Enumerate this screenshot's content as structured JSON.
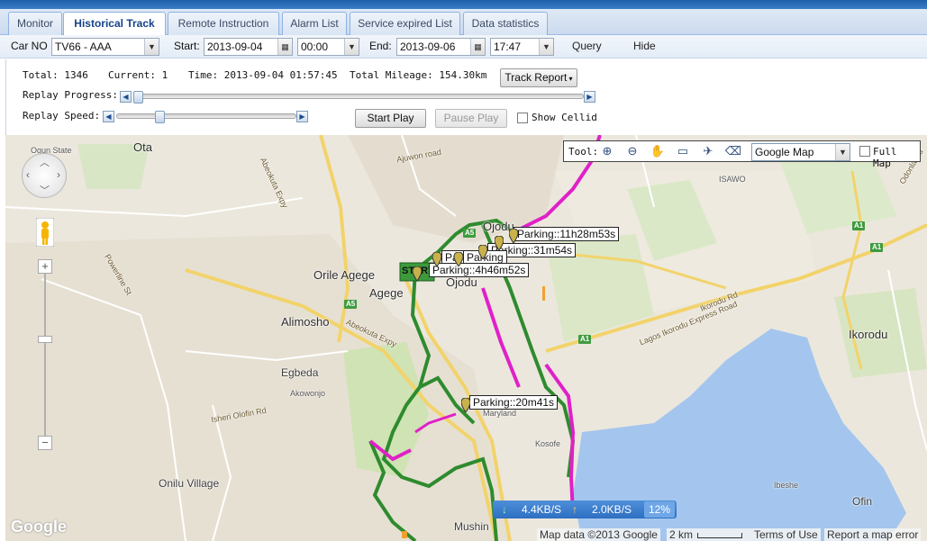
{
  "tabs": [
    {
      "label": "Monitor",
      "active": false
    },
    {
      "label": "Historical Track",
      "active": true
    },
    {
      "label": "Remote Instruction",
      "active": false
    },
    {
      "label": "Alarm List",
      "active": false
    },
    {
      "label": "Service expired List",
      "active": false
    },
    {
      "label": "Data statistics",
      "active": false
    }
  ],
  "query": {
    "car_label": "Car NO",
    "car_value": "TV66 - AAA",
    "start_label": "Start:",
    "start_date": "2013-09-04",
    "start_time": "00:00",
    "end_label": "End:",
    "end_date": "2013-09-06",
    "end_time": "17:47",
    "query_label": "Query",
    "hide_label": "Hide"
  },
  "info": {
    "total": "Total: 1346",
    "current": "Current: 1",
    "time": "Time: 2013-09-04 01:57:45",
    "mileage": "Total Mileage: 154.30km",
    "track_report": "Track Report",
    "replay_progress": "Replay Progress:",
    "replay_speed": "Replay Speed:",
    "progress_value": 0,
    "speed_value": 0.23,
    "start_play": "Start Play",
    "pause_play": "Pause Play",
    "show_cellid": "Show Cellid"
  },
  "map": {
    "tool_label": "Tool:",
    "map_type": "Google Map",
    "full_map": "Full Map",
    "start_label": "START",
    "callouts": [
      {
        "text": "Parking::11h28m53s"
      },
      {
        "text": "Parking::31m54s"
      },
      {
        "text": "Parking::4h46m52s"
      },
      {
        "text": "Parking::20m41s"
      },
      {
        "text": "Par"
      },
      {
        "text": "Parking"
      }
    ],
    "places": {
      "ota": "Ota",
      "orile_agege": "Orile Agege",
      "agege": "Agege",
      "ojodu": "Ojodu",
      "alimosho": "Alimosho",
      "egbeda": "Egbeda",
      "akowonjo": "Akowonjo",
      "onilu_village": "Onilu Village",
      "kosofe": "Kosofe",
      "mushin": "Mushin",
      "ikorodu": "Ikorodu",
      "ofin": "Ofin",
      "isawo": "ISAWO",
      "ibeshe": "Ibeshe",
      "maryland": "Maryland",
      "ogun_state": "Ogun State",
      "ojodu_top": "Ojodu",
      "abeokuta_expy": "Abeokuta Expy",
      "abeokuta_expy2": "Abeokuta Expy",
      "ikorodu_rd": "Ikorodu Rd",
      "lagos_ikorodu": "Lagos Ikorodu Express Road",
      "ajuwon_road": "Ajuwon road",
      "powerline_st": "Powerline St",
      "igando": "Isheri Olofin Rd",
      "odonla_rd": "Odonla Rd"
    },
    "speed_down": "4.4KB/S",
    "speed_up": "2.0KB/S",
    "speed_pct": "12%",
    "attribution": "Map data ©2013 Google",
    "scale": "2 km",
    "terms": "Terms of Use",
    "report": "Report a map error",
    "logo": "Google",
    "colors": {
      "track_green": "#2e8b2e",
      "track_magenta": "#e020c8",
      "water": "#a4c6ee"
    }
  }
}
